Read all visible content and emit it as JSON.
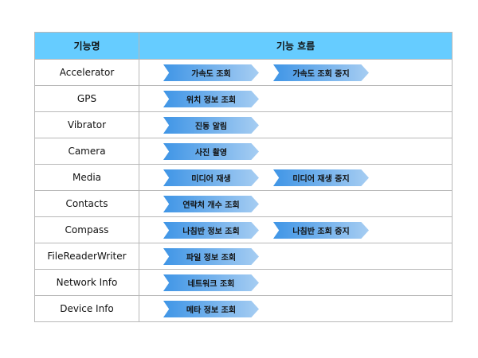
{
  "header": {
    "name": "기능명",
    "flow": "기능 흐름"
  },
  "rows": [
    {
      "name": "Accelerator",
      "steps": [
        "가속도 조회",
        "가속도 조회 중지"
      ]
    },
    {
      "name": "GPS",
      "steps": [
        "위치 정보 조회"
      ]
    },
    {
      "name": "Vibrator",
      "steps": [
        "진동 알림"
      ]
    },
    {
      "name": "Camera",
      "steps": [
        "사진 촬영"
      ]
    },
    {
      "name": "Media",
      "steps": [
        "미디어 재생",
        "미디어 재생 중지"
      ]
    },
    {
      "name": "Contacts",
      "steps": [
        "연락처 개수 조회"
      ]
    },
    {
      "name": "Compass",
      "steps": [
        "나침반 정보 조회",
        "나침반 조회 중지"
      ]
    },
    {
      "name": "FileReaderWriter",
      "steps": [
        "파일 정보 조회"
      ]
    },
    {
      "name": "Network Info",
      "steps": [
        "네트워크 조회"
      ]
    },
    {
      "name": "Device Info",
      "steps": [
        "메타 정보 조회"
      ]
    }
  ],
  "colors": {
    "header_bg": "#66ccff",
    "chevron_start": "#3f95e6",
    "chevron_end": "#a6cdf2"
  }
}
